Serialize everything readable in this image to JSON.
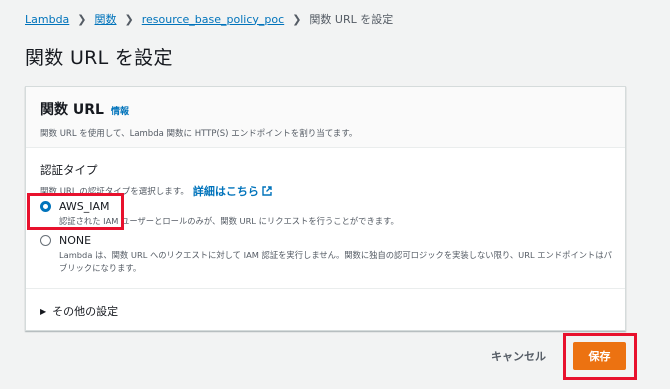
{
  "breadcrumb": {
    "items": [
      "Lambda",
      "関数",
      "resource_base_policy_poc"
    ],
    "current": "関数 URL を設定"
  },
  "page_title": "関数 URL を設定",
  "panel": {
    "title": "関数 URL",
    "info_link": "情報",
    "description": "関数 URL を使用して、Lambda 関数に HTTP(S) エンドポイントを割り当てます。"
  },
  "auth": {
    "label": "認証タイプ",
    "description": "関数 URL の認証タイプを選択します。",
    "detail_link": "詳細はこちら",
    "options": [
      {
        "label": "AWS_IAM",
        "description": "認証された IAM ユーザーとロールのみが、関数 URL にリクエストを行うことができます。",
        "selected": true
      },
      {
        "label": "NONE",
        "description": "Lambda は、関数 URL へのリクエストに対して IAM 認証を実行しません。関数に独自の認可ロジックを実装しない限り、URL エンドポイントはパブリックになります。",
        "selected": false
      }
    ]
  },
  "other_settings": {
    "label": "その他の設定"
  },
  "actions": {
    "cancel": "キャンセル",
    "save": "保存"
  },
  "colors": {
    "link": "#0073bb",
    "primary_button": "#ec7211",
    "highlight": "#e8112d"
  }
}
